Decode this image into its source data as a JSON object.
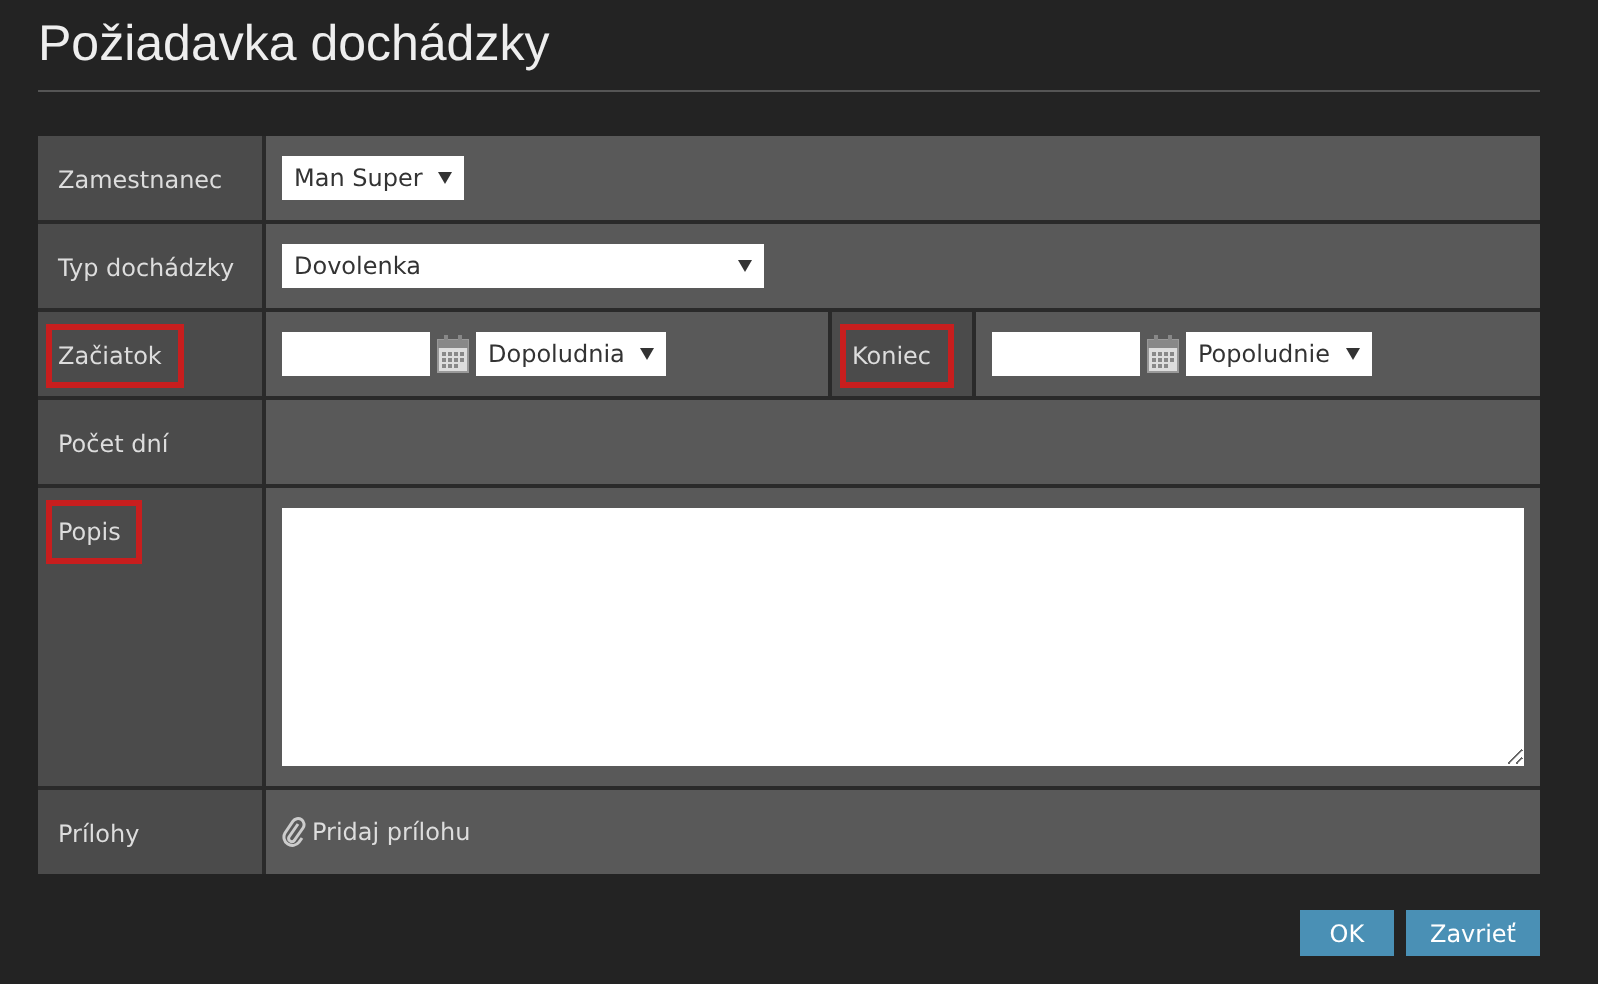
{
  "title": "Požiadavka dochádzky",
  "rows": [
    {
      "kind": "select",
      "label": "Zamestnanec",
      "highlighted": false,
      "value": "Man Super",
      "wide": false
    },
    {
      "kind": "select",
      "label": "Typ dochádzky",
      "highlighted": false,
      "value": "Dovolenka",
      "wide": true
    },
    {
      "kind": "range",
      "label": "Začiatok",
      "highlighted": true,
      "part": "Dopoludnia",
      "end_label": "Koniec",
      "end_highlighted": true,
      "end_part": "Popoludnie"
    },
    {
      "kind": "empty",
      "label": "Počet dní",
      "highlighted": false
    },
    {
      "kind": "textarea",
      "label": "Popis",
      "highlighted": true
    },
    {
      "kind": "attach",
      "label": "Prílohy",
      "highlighted": false,
      "link": "Pridaj prílohu"
    }
  ],
  "buttons": [
    "OK",
    "Zavrieť"
  ]
}
